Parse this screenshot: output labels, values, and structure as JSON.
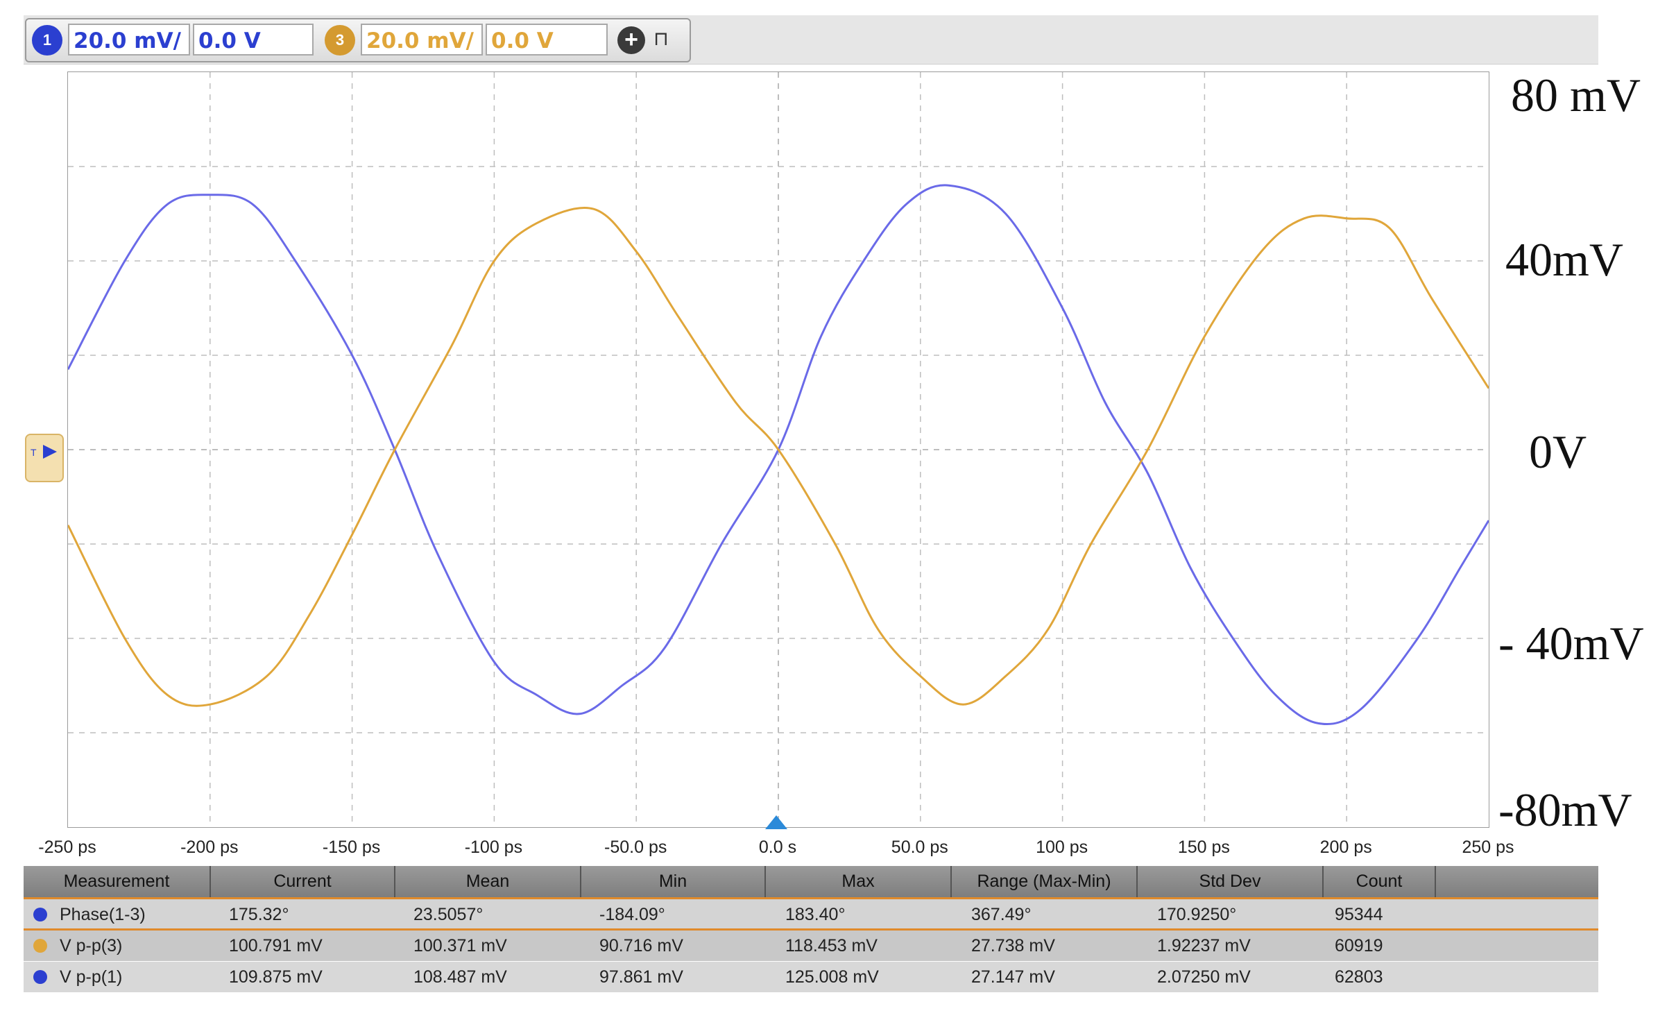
{
  "toolbar": {
    "ch1": {
      "badge": "1",
      "scale": "20.0 mV/",
      "offset": "0.0 V",
      "color": "#2b3fd0"
    },
    "ch3": {
      "badge": "3",
      "scale": "20.0 mV/",
      "offset": "0.0 V",
      "color": "#e0a63a"
    },
    "add_icon": "plus-circle-icon",
    "pin_icon": "pin-icon"
  },
  "axis": {
    "y_labels": [
      "80 mV",
      "40mV",
      "0V",
      "- 40mV",
      "-80mV"
    ],
    "x_ticks": [
      "-250 ps",
      "-200 ps",
      "-150 ps",
      "-100 ps",
      "-50.0 ps",
      "0.0 s",
      "50.0 ps",
      "100 ps",
      "150 ps",
      "200 ps",
      "250 ps"
    ]
  },
  "chart_data": {
    "type": "line",
    "xlim": [
      -250,
      250
    ],
    "ylim": [
      -80,
      80
    ],
    "grid": true,
    "series": [
      {
        "color": "#6a6ae8",
        "points": [
          [
            -250,
            17
          ],
          [
            -230,
            40
          ],
          [
            -215,
            52
          ],
          [
            -200,
            54
          ],
          [
            -185,
            52
          ],
          [
            -170,
            40
          ],
          [
            -150,
            20
          ],
          [
            -135,
            0
          ],
          [
            -120,
            -22
          ],
          [
            -100,
            -45
          ],
          [
            -85,
            -52
          ],
          [
            -70,
            -56
          ],
          [
            -55,
            -50
          ],
          [
            -40,
            -42
          ],
          [
            -20,
            -20
          ],
          [
            0,
            0
          ],
          [
            15,
            24
          ],
          [
            30,
            40
          ],
          [
            45,
            52
          ],
          [
            60,
            56
          ],
          [
            80,
            50
          ],
          [
            100,
            30
          ],
          [
            115,
            10
          ],
          [
            130,
            -5
          ],
          [
            145,
            -25
          ],
          [
            160,
            -40
          ],
          [
            175,
            -52
          ],
          [
            190,
            -58
          ],
          [
            205,
            -55
          ],
          [
            225,
            -40
          ],
          [
            240,
            -25
          ],
          [
            250,
            -15
          ]
        ]
      },
      {
        "color": "#e0a63a",
        "points": [
          [
            -250,
            -16
          ],
          [
            -230,
            -40
          ],
          [
            -215,
            -52
          ],
          [
            -200,
            -54
          ],
          [
            -180,
            -48
          ],
          [
            -165,
            -35
          ],
          [
            -150,
            -18
          ],
          [
            -135,
            0
          ],
          [
            -115,
            22
          ],
          [
            -100,
            40
          ],
          [
            -85,
            48
          ],
          [
            -65,
            51
          ],
          [
            -50,
            42
          ],
          [
            -35,
            28
          ],
          [
            -15,
            10
          ],
          [
            0,
            0
          ],
          [
            20,
            -20
          ],
          [
            35,
            -38
          ],
          [
            50,
            -48
          ],
          [
            65,
            -54
          ],
          [
            80,
            -48
          ],
          [
            95,
            -38
          ],
          [
            110,
            -20
          ],
          [
            130,
            0
          ],
          [
            150,
            24
          ],
          [
            170,
            42
          ],
          [
            185,
            49
          ],
          [
            200,
            49
          ],
          [
            215,
            47
          ],
          [
            230,
            32
          ],
          [
            250,
            13
          ]
        ]
      }
    ]
  },
  "measurements": {
    "headers": [
      "Measurement",
      "Current",
      "Mean",
      "Min",
      "Max",
      "Range (Max-Min)",
      "Std Dev",
      "Count"
    ],
    "rows": [
      {
        "dot_color": "#2b3fd0",
        "name": "Phase(1-3)",
        "current": "175.32°",
        "mean": "23.5057°",
        "min": "-184.09°",
        "max": "183.40°",
        "range": "367.49°",
        "std": "170.9250°",
        "count": "95344"
      },
      {
        "dot_color": "#e0a63a",
        "name": "V p-p(3)",
        "current": "100.791 mV",
        "mean": "100.371 mV",
        "min": "90.716 mV",
        "max": "118.453 mV",
        "range": "27.738 mV",
        "std": "1.92237 mV",
        "count": "60919"
      },
      {
        "dot_color": "#2b3fd0",
        "name": "V p-p(1)",
        "current": "109.875 mV",
        "mean": "108.487 mV",
        "min": "97.861 mV",
        "max": "125.008 mV",
        "range": "27.147 mV",
        "std": "2.07250 mV",
        "count": "62803"
      }
    ]
  }
}
